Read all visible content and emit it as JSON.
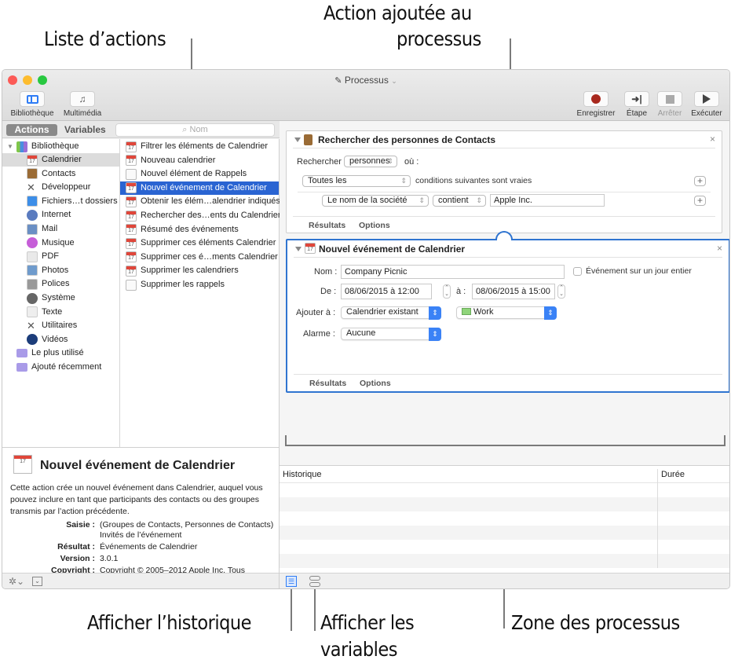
{
  "callouts": {
    "action_list": "Liste d’actions",
    "added_action_line1": "Action ajoutée au",
    "added_action_line2": "processus",
    "show_log": "Afficher l’historique",
    "show_variables_line1": "Afficher les",
    "show_variables_line2": "variables",
    "workflow_area": "Zone des processus"
  },
  "window": {
    "title": "Processus",
    "title_icon": "document-icon"
  },
  "toolbar": {
    "left": [
      {
        "label": "Bibliothèque",
        "icon": "sidebar-icon"
      },
      {
        "label": "Multimédia",
        "icon": "media-icon"
      }
    ],
    "right": [
      {
        "label": "Enregistrer",
        "icon": "record-icon",
        "enabled": true
      },
      {
        "label": "Étape",
        "icon": "step-icon",
        "enabled": true
      },
      {
        "label": "Arrêter",
        "icon": "stop-icon",
        "enabled": false
      },
      {
        "label": "Exécuter",
        "icon": "run-icon",
        "enabled": true
      }
    ]
  },
  "library_tabs": {
    "actions": "Actions",
    "variables": "Variables",
    "search_placeholder": "Nom"
  },
  "library": {
    "root": "Bibliothèque",
    "items": [
      {
        "label": "Calendrier",
        "icon": "calendar-icon",
        "selected": true
      },
      {
        "label": "Contacts",
        "icon": "contacts-icon"
      },
      {
        "label": "Développeur",
        "icon": "developer-icon"
      },
      {
        "label": "Fichiers…t dossiers",
        "icon": "finder-icon"
      },
      {
        "label": "Internet",
        "icon": "internet-icon"
      },
      {
        "label": "Mail",
        "icon": "mail-icon"
      },
      {
        "label": "Musique",
        "icon": "music-icon"
      },
      {
        "label": "PDF",
        "icon": "pdf-icon"
      },
      {
        "label": "Photos",
        "icon": "photos-icon"
      },
      {
        "label": "Polices",
        "icon": "fonts-icon"
      },
      {
        "label": "Système",
        "icon": "system-icon"
      },
      {
        "label": "Texte",
        "icon": "text-icon"
      },
      {
        "label": "Utilitaires",
        "icon": "utilities-icon"
      },
      {
        "label": "Vidéos",
        "icon": "videos-icon"
      }
    ],
    "smart_folders": [
      {
        "label": "Le plus utilisé",
        "icon": "smart-folder-icon"
      },
      {
        "label": "Ajouté récemment",
        "icon": "smart-folder-icon"
      }
    ]
  },
  "actions": [
    {
      "label": "Filtrer les éléments de Calendrier",
      "icon": "calendar-icon"
    },
    {
      "label": "Nouveau calendrier",
      "icon": "calendar-icon"
    },
    {
      "label": "Nouvel élément de Rappels",
      "icon": "reminders-icon"
    },
    {
      "label": "Nouvel événement de Calendrier",
      "icon": "calendar-icon",
      "selected": true
    },
    {
      "label": "Obtenir les élém…alendrier indiqués",
      "icon": "calendar-icon"
    },
    {
      "label": "Rechercher des…ents du Calendrier",
      "icon": "calendar-icon"
    },
    {
      "label": "Résumé des événements",
      "icon": "calendar-icon"
    },
    {
      "label": "Supprimer ces éléments Calendrier",
      "icon": "calendar-icon"
    },
    {
      "label": "Supprimer ces é…ments Calendrier",
      "icon": "calendar-icon"
    },
    {
      "label": "Supprimer les calendriers",
      "icon": "calendar-icon"
    },
    {
      "label": "Supprimer les rappels",
      "icon": "reminders-icon"
    }
  ],
  "description": {
    "title": "Nouvel événement de Calendrier",
    "body": "Cette action crée un nouvel événement dans Calendrier, auquel vous pouvez inclure en tant que participants des contacts ou des groupes transmis par l’action précédente.",
    "fields": [
      {
        "key": "Saisie :",
        "value": "(Groupes de Contacts, Personnes de Contacts)",
        "value2": "Invités de l’événement"
      },
      {
        "key": "Résultat :",
        "value": "Événements de Calendrier"
      },
      {
        "key": "Version :",
        "value": "3.0.1"
      },
      {
        "key": "Copyright :",
        "value": "Copyright © 2005–2012 Apple Inc. Tous"
      }
    ]
  },
  "workflow": {
    "card1": {
      "title": "Rechercher des personnes de Contacts",
      "search_label": "Rechercher",
      "search_value": "personnes",
      "where_label": "où :",
      "match_value": "Toutes les",
      "match_suffix": "conditions suivantes sont vraies",
      "field_value": "Le nom de la société",
      "operator_value": "contient",
      "criteria_value": "Apple Inc.",
      "tab_results": "Résultats",
      "tab_options": "Options"
    },
    "card2": {
      "title": "Nouvel événement de Calendrier",
      "name_label": "Nom :",
      "name_value": "Company Picnic",
      "allday_label": "Événement sur un jour entier",
      "allday_checked": false,
      "from_label": "De :",
      "from_value": "08/06/2015 à 12:00",
      "to_label": "à :",
      "to_value": "08/06/2015 à 15:00",
      "add_to_label": "Ajouter à :",
      "add_to_value": "Calendrier existant",
      "calendar_value": "Work",
      "calendar_color": "#8fd47a",
      "alarm_label": "Alarme :",
      "alarm_value": "Aucune",
      "tab_results": "Résultats",
      "tab_options": "Options"
    }
  },
  "log": {
    "col_history": "Historique",
    "col_duration": "Durée"
  },
  "colors": {
    "accent": "#2f74d0",
    "selection": "#2a64d2",
    "record": "#a8281d"
  }
}
